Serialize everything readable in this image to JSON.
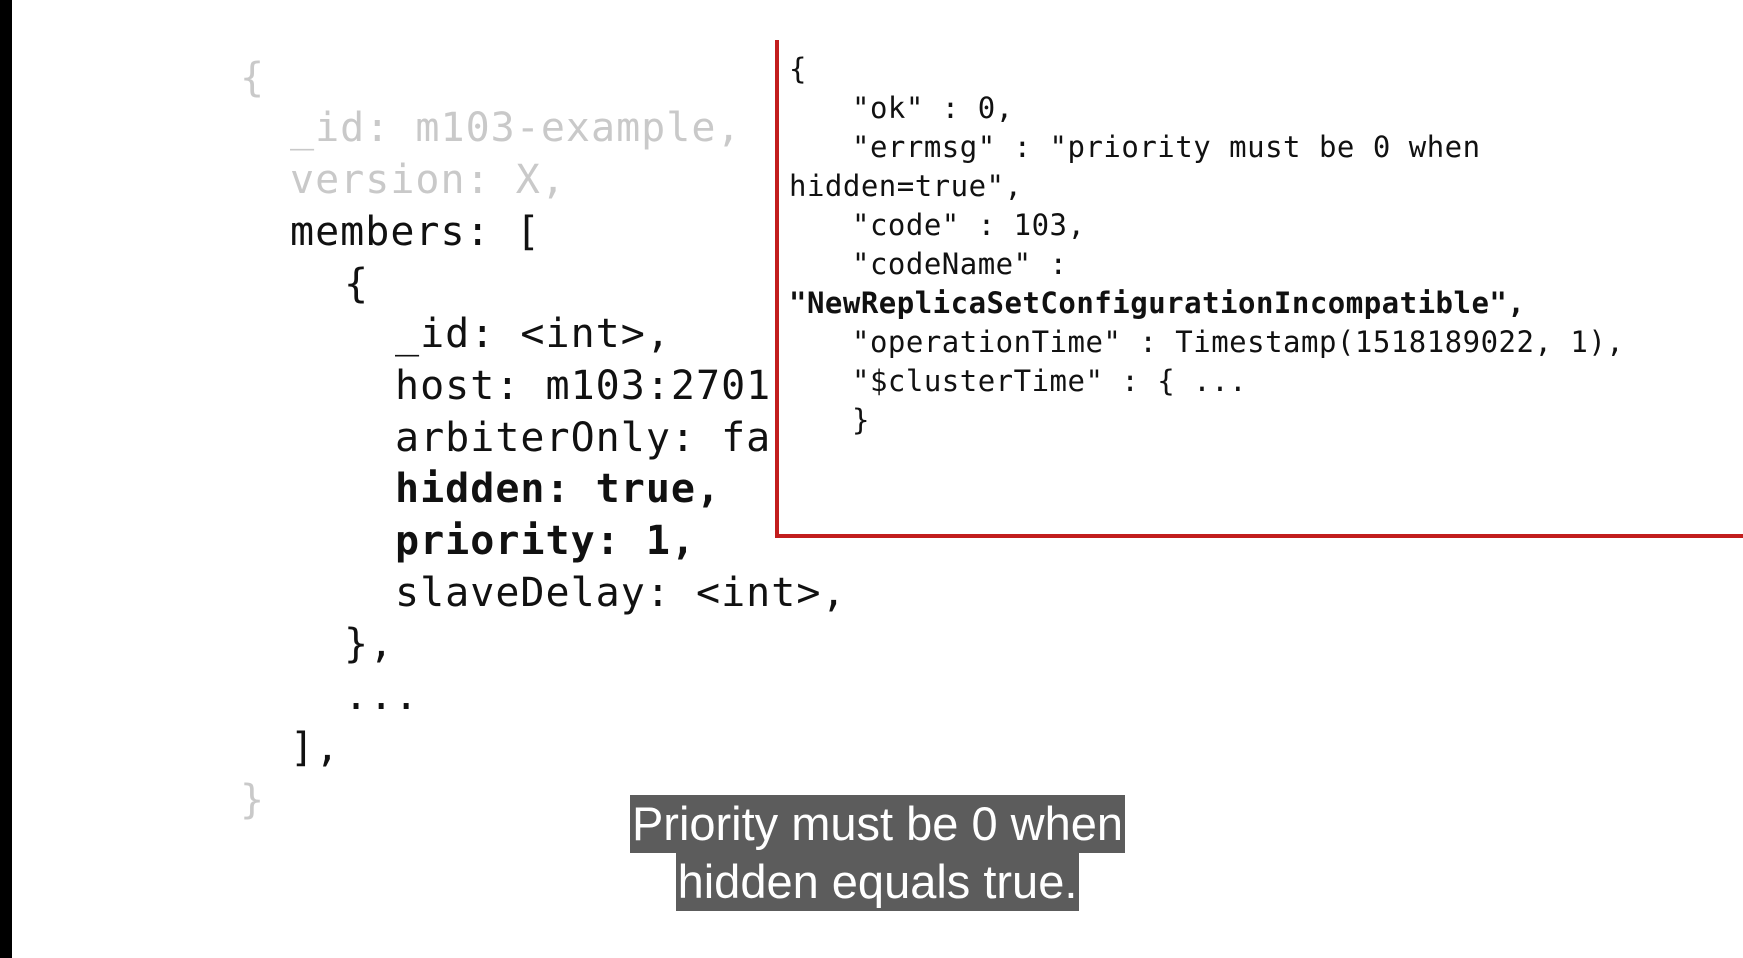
{
  "left_config": {
    "open_brace": "{",
    "id_line": "_id: m103-example,",
    "version_line": "version: X,",
    "members_line": "members: [",
    "member_open": "{",
    "member_id_line": "_id: <int>,",
    "host_line": "host: m103:2701",
    "arbiter_line": "arbiterOnly: fa",
    "hidden_line": "hidden: true,",
    "priority_line": "priority: 1,",
    "slave_delay_line": "slaveDelay: <int>,",
    "member_close": "},",
    "ellipsis": "...",
    "members_close": "],",
    "close_brace": "}"
  },
  "error_output": {
    "open_brace": "{",
    "ok_line": "\"ok\" : 0,",
    "errmsg_line_1": "\"errmsg\" : \"priority must be 0 when",
    "errmsg_line_2": "hidden=true\",",
    "code_line": "\"code\" : 103,",
    "codename_key_line": "\"codeName\" :",
    "codename_value_line": "\"NewReplicaSetConfigurationIncompatible\",",
    "operation_time_line": "\"operationTime\" : Timestamp(1518189022, 1),",
    "cluster_time_line": "\"$clusterTime\" : { ...",
    "close_brace": "}"
  },
  "caption": {
    "line_1": "Priority must be 0 when",
    "line_2": "hidden equals true."
  },
  "colors": {
    "overlay_border": "#c21d1d",
    "faded_text": "#c9c9c9",
    "caption_bg": "#464646"
  }
}
